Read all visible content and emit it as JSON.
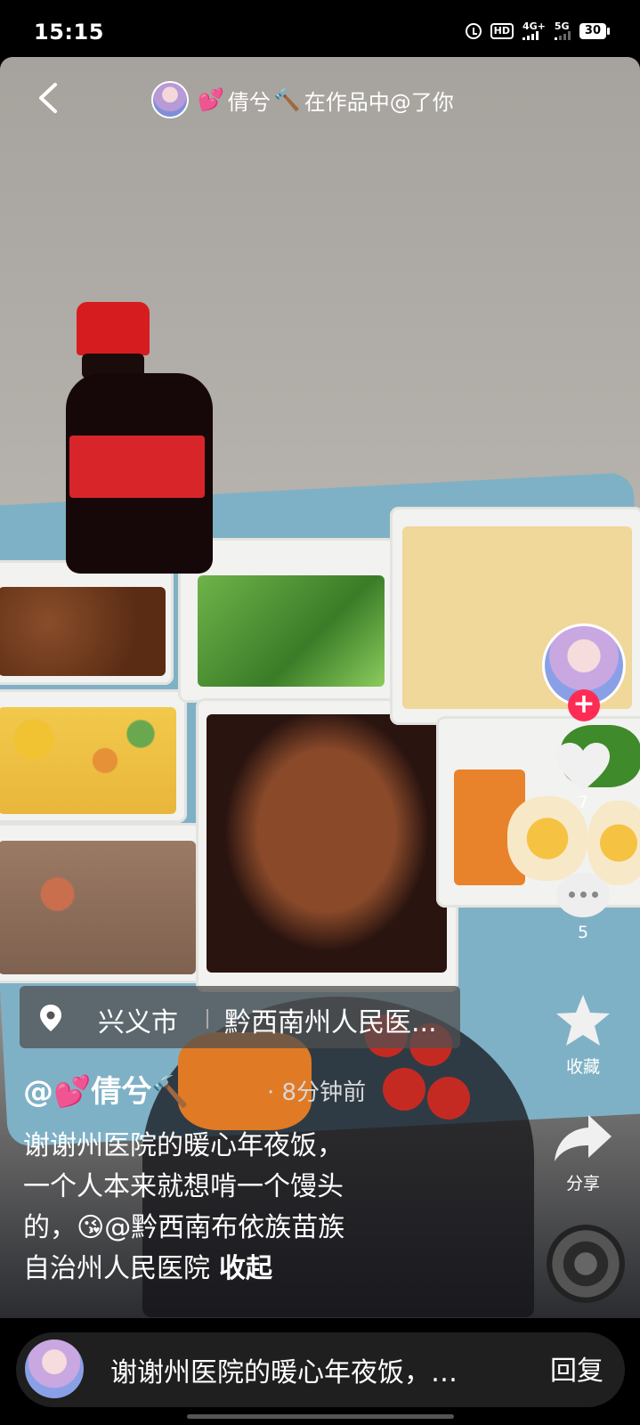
{
  "status_bar": {
    "time": "15:15",
    "hd": "HD",
    "net1": "4G+",
    "net2": "5G",
    "battery": "30"
  },
  "header": {
    "title_prefix_icon": "heart-icon",
    "author_name": "倩兮",
    "title_suffix_icon": "hammer-icon",
    "mention_text": "在作品中@了你",
    "back_icon": "back-arrow-icon"
  },
  "sidebar": {
    "like_count": "7",
    "comment_count": "5",
    "favorite_label": "收藏",
    "share_label": "分享"
  },
  "location": {
    "city": "兴义市",
    "place": "黔西南州人民医..."
  },
  "post": {
    "author_handle": "@💕倩兮🔨",
    "time_ago": "· 8分钟前",
    "caption_line1": "谢谢州医院的暖心年夜饭，",
    "caption_line2": "一个人本来就想啃一个馒头",
    "caption_line3": "的，😘@黔西南布依族苗族",
    "caption_line4": "自治州人民医院",
    "collapse_label": "收起"
  },
  "reply_bar": {
    "preview": "谢谢州医院的暖心年夜饭，…",
    "reply_label": "回复"
  },
  "colors": {
    "accent": "#fe2c55",
    "heart": "#ff4f9a"
  }
}
